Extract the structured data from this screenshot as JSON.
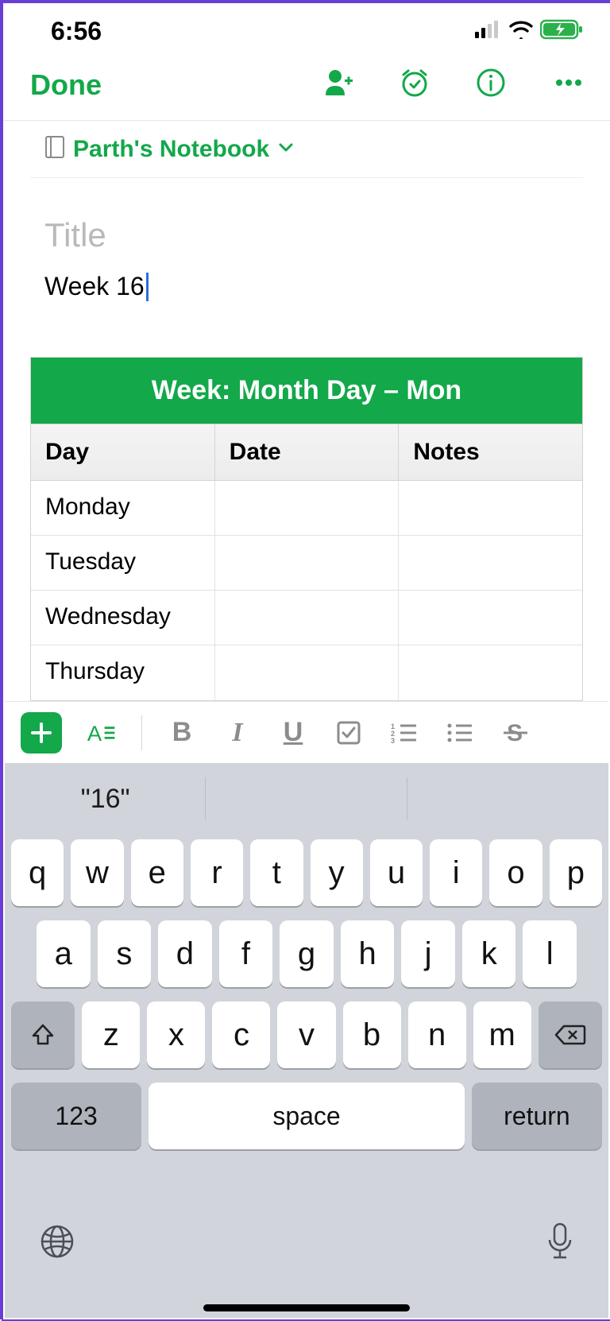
{
  "status": {
    "time": "6:56"
  },
  "nav": {
    "done": "Done"
  },
  "notebook": {
    "name": "Parth's Notebook"
  },
  "editor": {
    "title_placeholder": "Title",
    "body_text": "Week 16"
  },
  "table": {
    "title": "Week: Month Day – Mon",
    "headers": [
      "Day",
      "Date",
      "Notes"
    ],
    "rows": [
      {
        "day": "Monday",
        "date": "",
        "notes": ""
      },
      {
        "day": "Tuesday",
        "date": "",
        "notes": ""
      },
      {
        "day": "Wednesday",
        "date": "",
        "notes": ""
      },
      {
        "day": "Thursday",
        "date": "",
        "notes": ""
      }
    ]
  },
  "keyboard": {
    "suggestion": "\"16\"",
    "row1": [
      "q",
      "w",
      "e",
      "r",
      "t",
      "y",
      "u",
      "i",
      "o",
      "p"
    ],
    "row2": [
      "a",
      "s",
      "d",
      "f",
      "g",
      "h",
      "j",
      "k",
      "l"
    ],
    "row3": [
      "z",
      "x",
      "c",
      "v",
      "b",
      "n",
      "m"
    ],
    "num": "123",
    "space": "space",
    "ret": "return"
  }
}
